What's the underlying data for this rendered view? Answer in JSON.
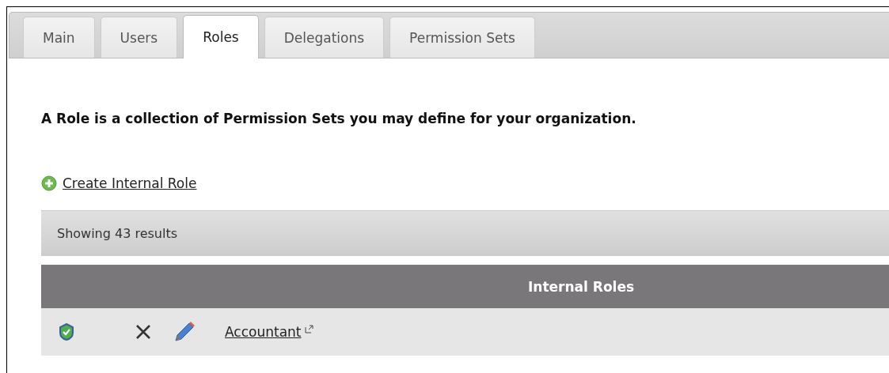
{
  "tabs": [
    {
      "label": "Main",
      "selected": false
    },
    {
      "label": "Users",
      "selected": false
    },
    {
      "label": "Roles",
      "selected": true
    },
    {
      "label": "Delegations",
      "selected": false
    },
    {
      "label": "Permission Sets",
      "selected": false
    }
  ],
  "intro": "A Role is a collection of Permission Sets you may define for your organization.",
  "create_link": "Create Internal Role",
  "results": "Showing 43 results",
  "table": {
    "header": "Internal Roles",
    "rows": [
      {
        "name": "Accountant"
      }
    ]
  }
}
